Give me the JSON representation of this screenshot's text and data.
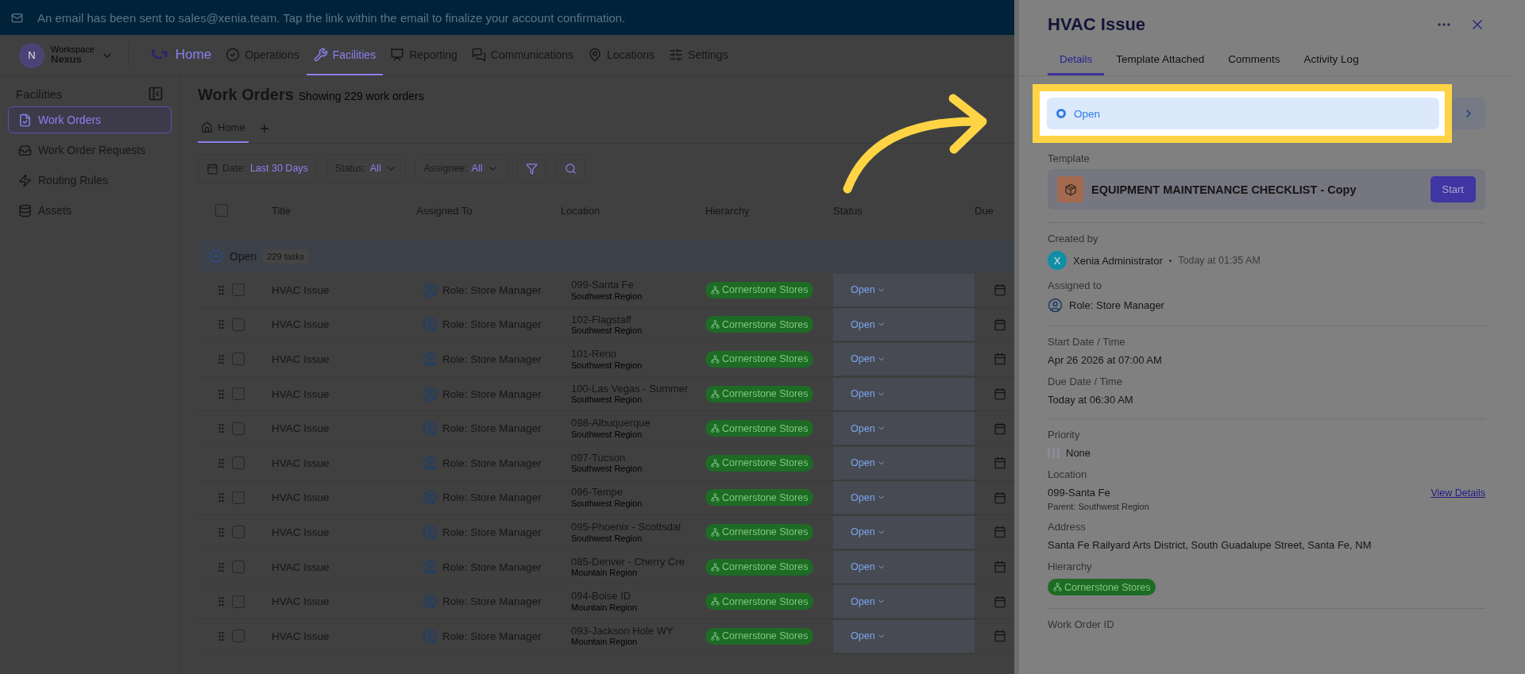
{
  "banner": {
    "text": "An email has been sent to sales@xenia.team. Tap the link within the email to finalize your account confirmation."
  },
  "workspace": {
    "avatar": "N",
    "label": "Workspace",
    "name": "Nexus"
  },
  "nav": [
    {
      "label": "Home",
      "kind": "brand",
      "selected": false
    },
    {
      "label": "Operations",
      "kind": "operations",
      "selected": false
    },
    {
      "label": "Facilities",
      "kind": "facilities",
      "selected": true
    },
    {
      "label": "Reporting",
      "kind": "reporting",
      "selected": false
    },
    {
      "label": "Communications",
      "kind": "communications",
      "selected": false
    },
    {
      "label": "Locations",
      "kind": "locations",
      "selected": false
    },
    {
      "label": "Settings",
      "kind": "settings",
      "selected": false
    }
  ],
  "sidebar": {
    "title": "Facilities",
    "items": [
      {
        "label": "Work Orders",
        "kind": "orders",
        "selected": true
      },
      {
        "label": "Work Order Requests",
        "kind": "requests",
        "selected": false
      },
      {
        "label": "Routing Rules",
        "kind": "rules",
        "selected": false
      },
      {
        "label": "Assets",
        "kind": "assets",
        "selected": false
      }
    ]
  },
  "page": {
    "title": "Work Orders",
    "subtitle": "Showing 229 work orders"
  },
  "view_tabs": [
    {
      "label": "Home",
      "selected": true
    }
  ],
  "filters": [
    {
      "label": "Date:",
      "value": "Last 30 Days",
      "kind": "date"
    },
    {
      "label": "Status:",
      "value": "All",
      "kind": "dropdown"
    },
    {
      "label": "Assignee:",
      "value": "All",
      "kind": "dropdown"
    }
  ],
  "table": {
    "select_all_checked": false,
    "columns": [
      "Title",
      "Assigned To",
      "Location",
      "Hierarchy",
      "Status",
      "Due"
    ],
    "group": {
      "label": "Open",
      "count": "229 tasks",
      "expanded": true
    },
    "rows": [
      {
        "title": "HVAC Issue",
        "assignee": "Role: Store Manager",
        "location": "099-Santa Fe",
        "region": "Southwest Region",
        "hierarchy": "Cornerstone Stores",
        "status": "Open",
        "checked": false
      },
      {
        "title": "HVAC Issue",
        "assignee": "Role: Store Manager",
        "location": "102-Flagstaff",
        "region": "Southwest Region",
        "hierarchy": "Cornerstone Stores",
        "status": "Open",
        "checked": false
      },
      {
        "title": "HVAC Issue",
        "assignee": "Role: Store Manager",
        "location": "101-Reno",
        "region": "Southwest Region",
        "hierarchy": "Cornerstone Stores",
        "status": "Open",
        "checked": false
      },
      {
        "title": "HVAC Issue",
        "assignee": "Role: Store Manager",
        "location": "100-Las Vegas - Summer",
        "region": "Southwest Region",
        "hierarchy": "Cornerstone Stores",
        "status": "Open",
        "checked": false
      },
      {
        "title": "HVAC Issue",
        "assignee": "Role: Store Manager",
        "location": "098-Albuquerque",
        "region": "Southwest Region",
        "hierarchy": "Cornerstone Stores",
        "status": "Open",
        "checked": false
      },
      {
        "title": "HVAC Issue",
        "assignee": "Role: Store Manager",
        "location": "097-Tucson",
        "region": "Southwest Region",
        "hierarchy": "Cornerstone Stores",
        "status": "Open",
        "checked": false
      },
      {
        "title": "HVAC Issue",
        "assignee": "Role: Store Manager",
        "location": "096-Tempe",
        "region": "Southwest Region",
        "hierarchy": "Cornerstone Stores",
        "status": "Open",
        "checked": false
      },
      {
        "title": "HVAC Issue",
        "assignee": "Role: Store Manager",
        "location": "095-Phoenix - Scottsdal",
        "region": "Southwest Region",
        "hierarchy": "Cornerstone Stores",
        "status": "Open",
        "checked": false
      },
      {
        "title": "HVAC Issue",
        "assignee": "Role: Store Manager",
        "location": "085-Denver - Cherry Cre",
        "region": "Mountain Region",
        "hierarchy": "Cornerstone Stores",
        "status": "Open",
        "checked": false
      },
      {
        "title": "HVAC Issue",
        "assignee": "Role: Store Manager",
        "location": "094-Boise ID",
        "region": "Mountain Region",
        "hierarchy": "Cornerstone Stores",
        "status": "Open",
        "checked": false
      },
      {
        "title": "HVAC Issue",
        "assignee": "Role: Store Manager",
        "location": "093-Jackson Hole WY",
        "region": "Mountain Region",
        "hierarchy": "Cornerstone Stores",
        "status": "Open",
        "checked": false
      }
    ]
  },
  "panel": {
    "title": "HVAC Issue",
    "tabs": [
      {
        "label": "Details",
        "selected": true
      },
      {
        "label": "Template Attached",
        "selected": false
      },
      {
        "label": "Comments",
        "selected": false
      },
      {
        "label": "Activity Log",
        "selected": false
      }
    ],
    "status": {
      "value": "Open"
    },
    "template": {
      "label": "Template",
      "name": "EQUIPMENT MAINTENANCE CHECKLIST - Copy",
      "button": "Start"
    },
    "created_by": {
      "label": "Created by",
      "avatar": "X",
      "name": "Xenia Administrator",
      "separator": "•",
      "time": "Today at 01:35 AM"
    },
    "assigned_to": {
      "label": "Assigned to",
      "value": "Role: Store Manager"
    },
    "start": {
      "label": "Start Date / Time",
      "value": "Apr 26 2026 at 07:00 AM"
    },
    "due": {
      "label": "Due Date / Time",
      "value": "Today at 06:30 AM"
    },
    "priority": {
      "label": "Priority",
      "value": "None"
    },
    "location": {
      "label": "Location",
      "value": "099-Santa Fe",
      "link": "View Details",
      "parent": "Parent: Southwest Region"
    },
    "address": {
      "label": "Address",
      "value": "Santa Fe Railyard Arts District, South Guadalupe Street, Santa Fe, NM"
    },
    "hierarchy": {
      "label": "Hierarchy",
      "value": "Cornerstone Stores"
    },
    "work_order_id": {
      "label": "Work Order ID"
    }
  }
}
